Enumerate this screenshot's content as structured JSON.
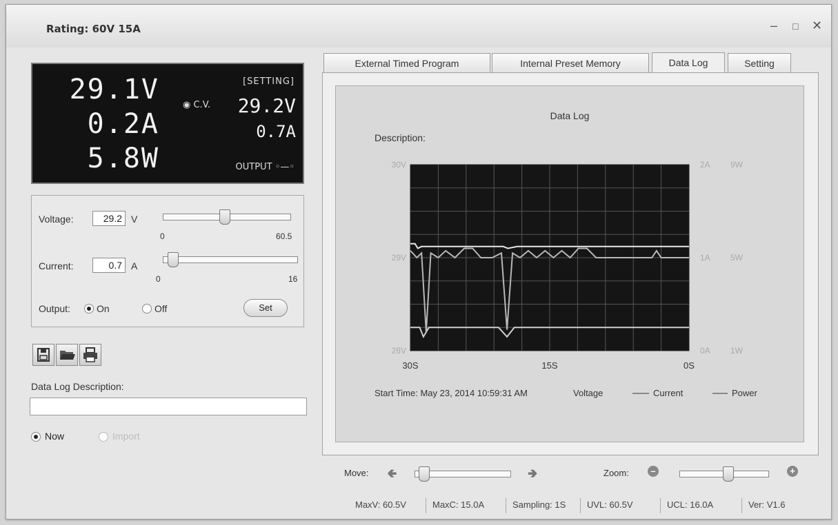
{
  "window": {
    "title": "Rating: 60V 15A"
  },
  "display": {
    "voltage": "29.1V",
    "current": "0.2A",
    "power": "5.8W",
    "setting_label": "[SETTING]",
    "mode": "C.V.",
    "set_voltage": "29.2V",
    "set_current": "0.7A",
    "output_label": "OUTPUT"
  },
  "controls": {
    "voltage_label": "Voltage:",
    "voltage_value": "29.2",
    "voltage_unit": "V",
    "voltage_min": "0",
    "voltage_max": "60.5",
    "voltage_fraction": 0.48,
    "current_label": "Current:",
    "current_value": "0.7",
    "current_unit": "A",
    "current_min": "0",
    "current_max": "16",
    "current_fraction": 0.04,
    "output_label": "Output:",
    "on_label": "On",
    "off_label": "Off",
    "output_on": true,
    "set_label": "Set"
  },
  "toolbar": {
    "save_icon": "save-icon",
    "open_icon": "folder-open-icon",
    "print_icon": "printer-icon"
  },
  "log": {
    "description_label": "Data Log Description:",
    "now_label": "Now",
    "import_label": "Import"
  },
  "tabs": [
    {
      "label": "External Timed Program",
      "active": false
    },
    {
      "label": "Internal Preset Memory",
      "active": false
    },
    {
      "label": "Data Log",
      "active": true
    },
    {
      "label": "Setting",
      "active": false
    }
  ],
  "chart_data": {
    "type": "line",
    "title": "Data Log",
    "description_label": "Description:",
    "x_ticks": [
      "30S",
      "15S",
      "0S"
    ],
    "x_range": [
      30,
      0
    ],
    "y_left_ticks": [
      "30V",
      "29V",
      "28V"
    ],
    "y_left_range": [
      28,
      30
    ],
    "y_right1_ticks": [
      "2A",
      "1A",
      "0A"
    ],
    "y_right1_range": [
      0,
      2
    ],
    "y_right2_ticks": [
      "9W",
      "5W",
      "1W"
    ],
    "y_right2_range": [
      1,
      9
    ],
    "grid": true,
    "start_time": "Start Time: May 23, 2014 10:59:31 AM",
    "legend_position": "bottom",
    "series": [
      {
        "name": "Voltage",
        "color": "#e8e8e8",
        "x": [
          30,
          29.5,
          29.2,
          28.8,
          27,
          20,
          19.5,
          18.5,
          17,
          0
        ],
        "y": [
          29.15,
          29.15,
          29.1,
          29.12,
          29.12,
          29.12,
          29.1,
          29.12,
          29.12,
          29.12
        ]
      },
      {
        "name": "Current",
        "color": "#d0d0d0",
        "x": [
          30,
          29,
          28.6,
          28,
          27,
          25,
          23.5,
          20.5,
          19.6,
          18.8,
          18,
          17,
          16,
          15,
          14,
          13,
          12,
          11,
          10,
          9,
          8,
          7,
          6,
          5,
          4,
          3,
          2,
          1,
          0
        ],
        "y": [
          0.25,
          0.25,
          0.15,
          0.25,
          0.25,
          0.25,
          0.25,
          0.25,
          0.15,
          0.25,
          0.25,
          0.25,
          0.25,
          0.25,
          0.25,
          0.25,
          0.25,
          0.25,
          0.25,
          0.25,
          0.25,
          0.25,
          0.25,
          0.25,
          0.25,
          0.25,
          0.25,
          0.25,
          0.25
        ]
      },
      {
        "name": "Power",
        "color": "#b8b8b8",
        "x": [
          30,
          29.3,
          28.8,
          28.3,
          27.8,
          27,
          26.2,
          25.2,
          24.2,
          23.3,
          22.4,
          21.2,
          20.2,
          19.6,
          19,
          18.2,
          17.3,
          16.4,
          15.5,
          14.6,
          13.7,
          12.8,
          11.9,
          11,
          10,
          9,
          8,
          7,
          6,
          5,
          4,
          3.5,
          3,
          2,
          1,
          0
        ],
        "y": [
          5.3,
          5.0,
          5.2,
          1.8,
          5.2,
          5.0,
          5.3,
          5.0,
          5.4,
          5.4,
          5.0,
          5.0,
          5.2,
          1.9,
          5.2,
          5.0,
          5.3,
          5.0,
          5.3,
          5.0,
          5.3,
          5.0,
          5.4,
          5.4,
          5.0,
          5.0,
          5.0,
          5.0,
          5.0,
          5.0,
          5.0,
          5.3,
          5.0,
          5.0,
          5.0,
          5.0
        ]
      }
    ]
  },
  "chart_legend": {
    "voltage": "Voltage",
    "current": "Current",
    "power": "Power"
  },
  "nav": {
    "move_label": "Move:",
    "zoom_label": "Zoom:",
    "move_fraction": 0.05,
    "zoom_fraction": 0.55
  },
  "status": {
    "maxv": "MaxV: 60.5V",
    "maxc": "MaxC: 15.0A",
    "sampling": "Sampling: 1S",
    "uvl": "UVL: 60.5V",
    "ucl": "UCL: 16.0A",
    "version": "Ver: V1.6"
  }
}
